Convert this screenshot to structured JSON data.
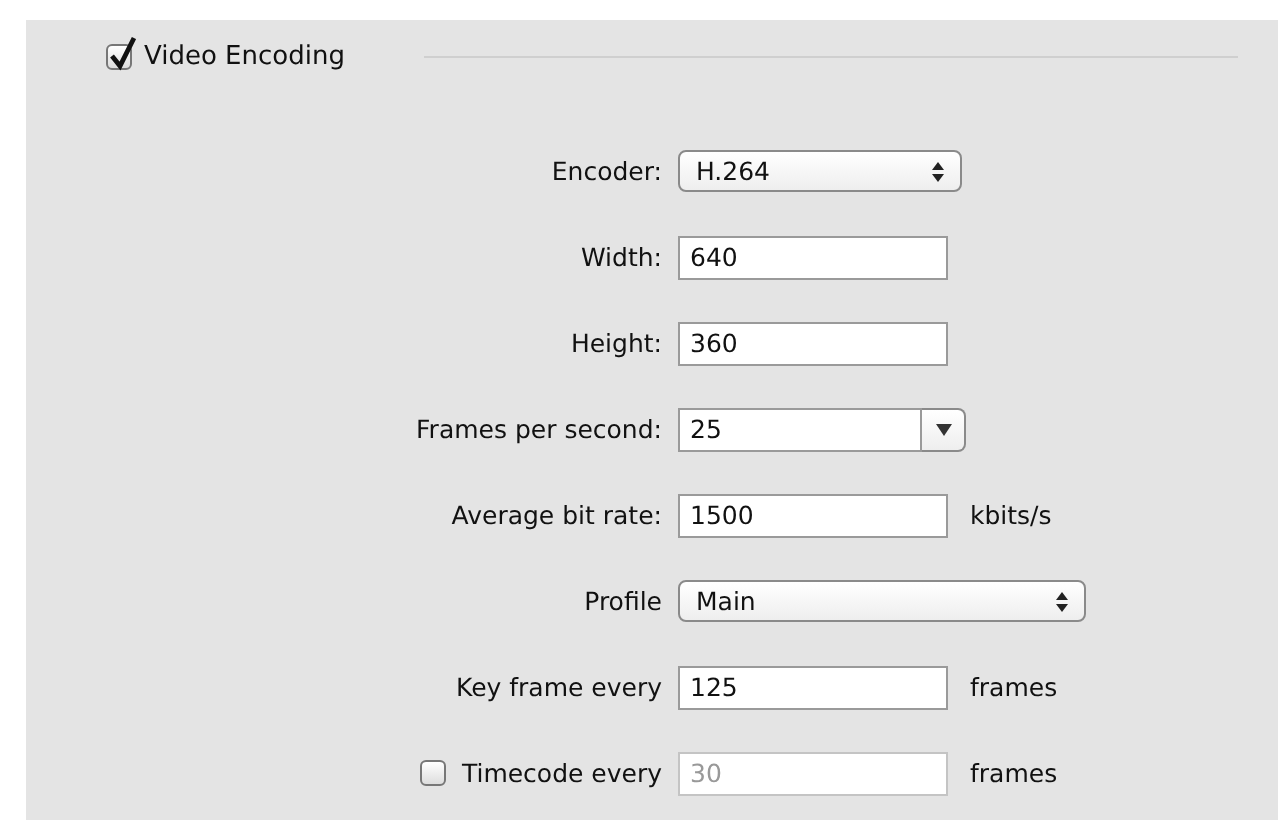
{
  "section": {
    "title": "Video Encoding",
    "checked": true
  },
  "rows": [
    {
      "kind": "popup",
      "label": "Encoder:",
      "value": "H.264"
    },
    {
      "kind": "text",
      "label": "Width:",
      "value": "640"
    },
    {
      "kind": "text",
      "label": "Height:",
      "value": "360"
    },
    {
      "kind": "combo",
      "label": "Frames per second:",
      "value": "25"
    },
    {
      "kind": "text",
      "label": "Average bit rate:",
      "value": "1500",
      "unit": "kbits/s"
    },
    {
      "kind": "widepopup",
      "label": "Profile",
      "value": "Main"
    },
    {
      "kind": "text",
      "label": "Key frame every",
      "value": "125",
      "unit": "frames"
    },
    {
      "kind": "text",
      "label": "Timecode every",
      "value": "30",
      "unit": "frames",
      "checkbox": {
        "checked": false
      },
      "disabled": true
    }
  ]
}
